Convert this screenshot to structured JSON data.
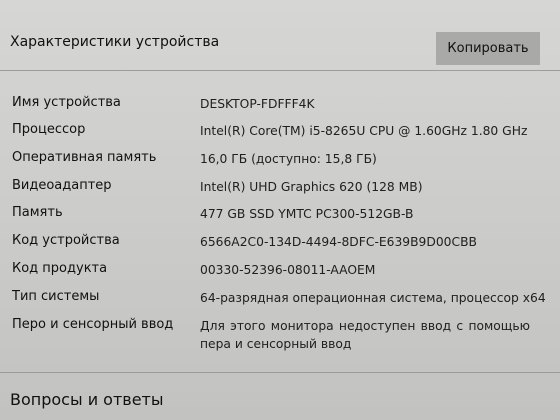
{
  "header": {
    "title": "Характеристики устройства",
    "copy_label": "Копировать"
  },
  "specs": [
    {
      "label": "Имя устройства",
      "value": "DESKTOP-FDFFF4K"
    },
    {
      "label": "Процессор",
      "value": "Intel(R) Core(TM) i5-8265U CPU @ 1.60GHz   1.80 GHz"
    },
    {
      "label": "Оперативная память",
      "value": "16,0 ГБ (доступно: 15,8 ГБ)"
    },
    {
      "label": "Видеоадаптер",
      "value": "Intel(R) UHD Graphics 620 (128 MB)"
    },
    {
      "label": "Память",
      "value": "477 GB SSD YMTC PC300-512GB-B"
    },
    {
      "label": "Код устройства",
      "value": "6566A2C0-134D-4494-8DFC-E639B9D00CBB"
    },
    {
      "label": "Код продукта",
      "value": "00330-52396-08011-AAOEM"
    },
    {
      "label": "Тип системы",
      "value": "64-разрядная операционная система, процессор x64"
    },
    {
      "label": "Перо и сенсорный ввод",
      "value": "Для этого монитора недоступен ввод с помощью пера и сенсорный ввод"
    }
  ],
  "faq": {
    "title": "Вопросы и ответы"
  }
}
